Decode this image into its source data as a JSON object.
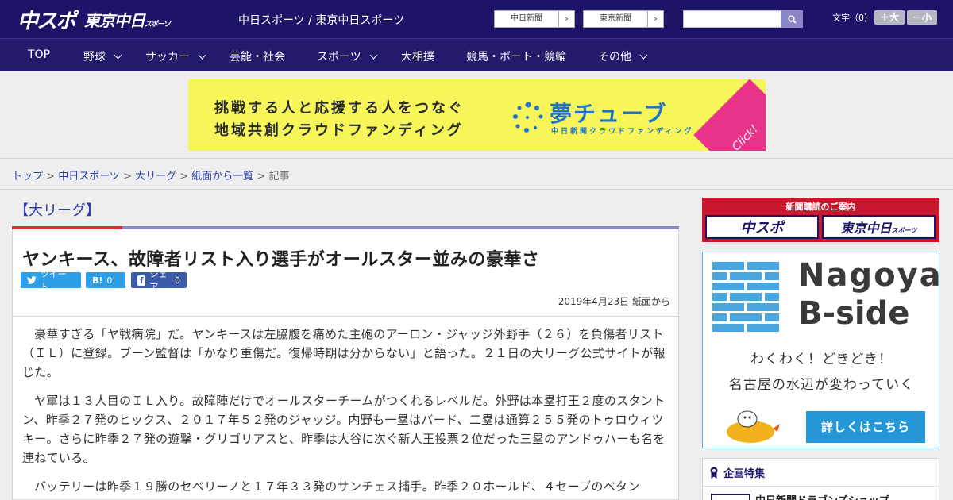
{
  "header": {
    "logo_main": "中スポ",
    "logo_sub": "東京中日",
    "logo_sub_small": "スポーツ",
    "title": "中日スポーツ / 東京中日スポーツ",
    "links": [
      {
        "label": "中日新聞",
        "arrow": "›"
      },
      {
        "label": "東京新聞",
        "arrow": "›"
      }
    ],
    "search": {
      "placeholder": ""
    },
    "font_size_label": "文字（0）",
    "font_plus": "＋大",
    "font_minus": "－小"
  },
  "nav": {
    "items": [
      {
        "label": "TOP",
        "dropdown": false
      },
      {
        "label": "野球",
        "dropdown": true
      },
      {
        "label": "サッカー",
        "dropdown": true
      },
      {
        "label": "芸能・社会",
        "dropdown": false
      },
      {
        "label": "スポーツ",
        "dropdown": true
      },
      {
        "label": "大相撲",
        "dropdown": false
      },
      {
        "label": "競馬・ボート・競輪",
        "dropdown": false
      },
      {
        "label": "その他",
        "dropdown": true
      }
    ]
  },
  "banner": {
    "line1": "挑戦する人と応援する人をつなぐ",
    "line2": "地域共創クラウドファンディング",
    "brand": "夢チューブ",
    "brand_sub": "中日新聞クラウドファンディング",
    "click": "Click!"
  },
  "breadcrumb": {
    "items": [
      "トップ",
      "中日スポーツ",
      "大リーグ",
      "紙面から一覧"
    ],
    "current": "記事",
    "separator": " > "
  },
  "article": {
    "category": "【大リーグ】",
    "headline": "ヤンキース、故障者リスト入り選手がオールスター並みの豪華さ",
    "share": {
      "tweet": "ツイート",
      "hatena_label": "B!",
      "hatena_count": "0",
      "facebook": "シェア",
      "facebook_count": "0"
    },
    "date": "2019年4月23日 紙面から",
    "paragraphs": [
      "豪華すぎる「ヤ戦病院」だ。ヤンキースは左脇腹を痛めた主砲のアーロン・ジャッジ外野手（２６）を負傷者リスト（ＩＬ）に登録。ブーン監督は「かなり重傷だ。復帰時期は分からない」と語った。２１日の大リーグ公式サイトが報じた。",
      "ヤ軍は１３人目のＩＬ入り。故障陣だけでオールスターチームがつくれるレベルだ。外野は本塁打王２度のスタントン、昨季２７発のヒックス、２０１７年５２発のジャッジ。内野も一塁はバード、二塁は通算２５５発のトゥロウィツキー。さらに昨季２７発の遊撃・グリゴリアスと、昨季は大谷に次ぐ新人王投票２位だった三塁のアンドゥハーも名を連ねている。",
      "バッテリーは昨季１９勝のセベリーノと１７年３３発のサンチェス捕手。昨季２０ホールド、４セーブのベタン"
    ]
  },
  "sidebar": {
    "subscribe_title": "新聞購読のご案内",
    "subscribe_a": "中スポ",
    "subscribe_b": "東京中日",
    "subscribe_b_small": "スポーツ",
    "bside_line1": "Nagoya",
    "bside_line2": "B-side",
    "bside_copy1": "わくわく！どきどき！",
    "bside_copy2": "名古屋の水辺が変わっていく",
    "bside_button": "詳しくはこちら",
    "feature_title": "企画特集",
    "feature_item": "中日新聞ドラゴンズショップ"
  },
  "colors": {
    "header_bg": "#1c1466",
    "nav_bg": "#241a6b",
    "banner_bg": "#f6f55a",
    "link": "#2a3ea8",
    "accent_red": "#d62f2f",
    "twitter": "#2e9ee6",
    "facebook": "#3b5aa8",
    "bside_blue": "#2597d7"
  }
}
